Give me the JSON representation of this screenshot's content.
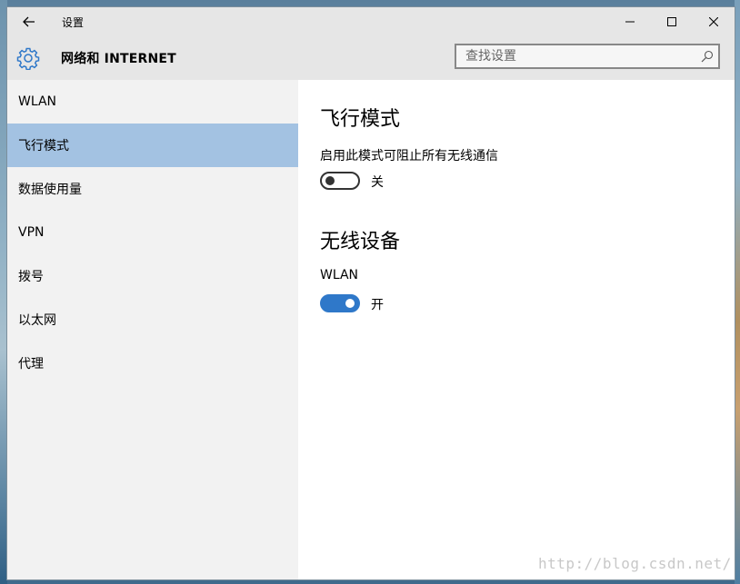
{
  "window": {
    "title": "设置",
    "minimize_glyph": "—",
    "maximize_glyph": "☐",
    "close_glyph": "✕"
  },
  "header": {
    "title": "网络和 INTERNET",
    "search_placeholder": "查找设置",
    "icon": "gear-icon"
  },
  "sidebar": {
    "items": [
      {
        "label": "WLAN"
      },
      {
        "label": "飞行模式",
        "selected": true
      },
      {
        "label": "数据使用量"
      },
      {
        "label": "VPN"
      },
      {
        "label": "拨号"
      },
      {
        "label": "以太网"
      },
      {
        "label": "代理"
      }
    ]
  },
  "content": {
    "airplane_title": "飞行模式",
    "airplane_desc": "启用此模式可阻止所有无线通信",
    "airplane_toggle": {
      "on": false,
      "label": "关"
    },
    "wireless_title": "无线设备",
    "wlan_label": "WLAN",
    "wlan_toggle": {
      "on": true,
      "label": "开"
    }
  },
  "watermark": "http://blog.csdn.net/",
  "colors": {
    "accent": "#2f78c9",
    "selected_nav": "#a3c2e2",
    "sidebar_bg": "#f2f2f2",
    "header_bg": "#e6e6e6"
  }
}
